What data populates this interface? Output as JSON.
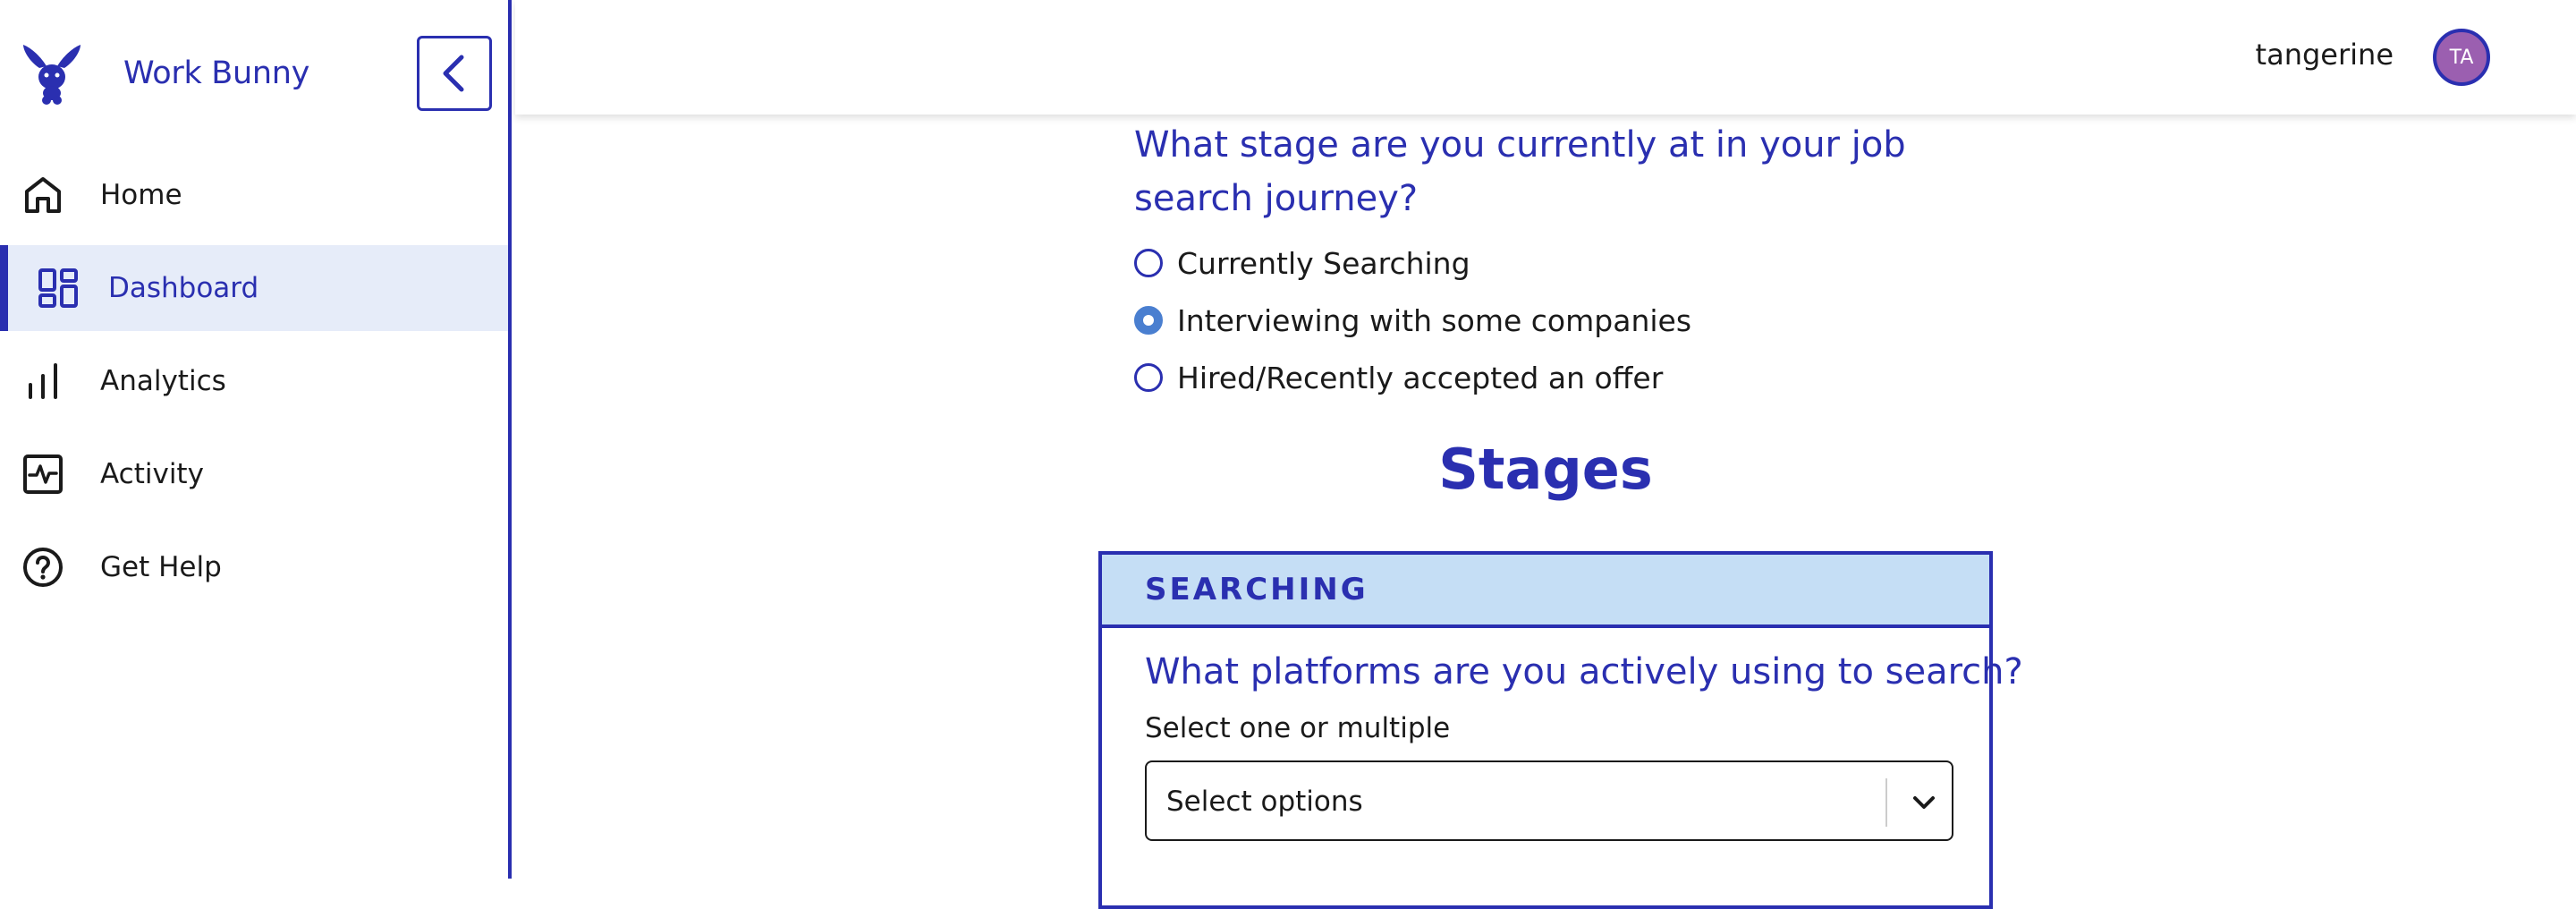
{
  "app": {
    "name": "Work Bunny"
  },
  "sidebar": {
    "items": [
      {
        "label": "Home",
        "icon": "home-icon",
        "active": false
      },
      {
        "label": "Dashboard",
        "icon": "dashboard-icon",
        "active": true
      },
      {
        "label": "Analytics",
        "icon": "bar-chart-icon",
        "active": false
      },
      {
        "label": "Activity",
        "icon": "activity-icon",
        "active": false
      },
      {
        "label": "Get Help",
        "icon": "help-icon",
        "active": false
      }
    ]
  },
  "header": {
    "username": "tangerine",
    "avatar_initials": "TA"
  },
  "question": {
    "title": "What stage are you currently at in your job search journey?",
    "options": [
      {
        "label": "Currently Searching",
        "selected": false
      },
      {
        "label": "Interviewing with some companies",
        "selected": true
      },
      {
        "label": "Hired/Recently accepted an offer",
        "selected": false
      }
    ]
  },
  "stages": {
    "title": "Stages",
    "card": {
      "header": "SEARCHING",
      "question": "What platforms are you actively using to search?",
      "hint": "Select one or multiple",
      "select_placeholder": "Select options"
    }
  },
  "colors": {
    "accent": "#2a2fb0",
    "active_bg": "#e6ecf9",
    "card_header_bg": "#c5def5",
    "radio_checked": "#4a7fd0",
    "avatar_bg": "#9b5fb0"
  }
}
